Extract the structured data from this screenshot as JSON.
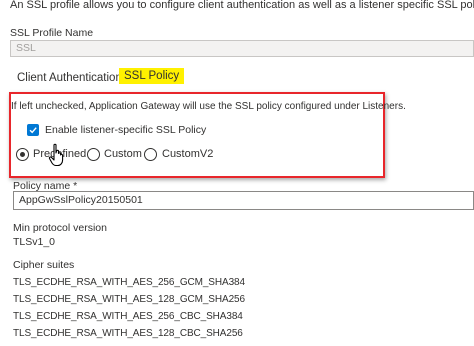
{
  "intro": "An SSL profile allows you to configure client authentication as well as a listener specific SSL policy.",
  "profile": {
    "label": "SSL Profile Name",
    "value": "SSL"
  },
  "tabs": [
    {
      "label": "Client Authentication",
      "active": false
    },
    {
      "label": "SSL Policy",
      "active": true
    }
  ],
  "policy_section": {
    "note": "If left unchecked, Application Gateway will use the SSL policy configured under Listeners.",
    "checkbox_label": "Enable listener-specific SSL Policy",
    "checkbox_checked": true,
    "radio_options": [
      {
        "label": "Predefined",
        "selected": true
      },
      {
        "label": "Custom",
        "selected": false
      },
      {
        "label": "CustomV2",
        "selected": false
      }
    ]
  },
  "policy_name": {
    "label": "Policy name *",
    "value": "AppGwSslPolicy20150501"
  },
  "min_protocol": {
    "label": "Min protocol version",
    "value": "TLSv1_0"
  },
  "cipher_suites": {
    "label": "Cipher suites",
    "items": [
      "TLS_ECDHE_RSA_WITH_AES_256_GCM_SHA384",
      "TLS_ECDHE_RSA_WITH_AES_128_GCM_SHA256",
      "TLS_ECDHE_RSA_WITH_AES_256_CBC_SHA384",
      "TLS_ECDHE_RSA_WITH_AES_128_CBC_SHA256"
    ]
  },
  "colors": {
    "highlight": "#fff100",
    "annotation_box": "#e8262b",
    "checkbox": "#0078d4"
  },
  "icons": {
    "checkbox": "checkmark-icon",
    "cursor": "hand-pointer-icon"
  }
}
